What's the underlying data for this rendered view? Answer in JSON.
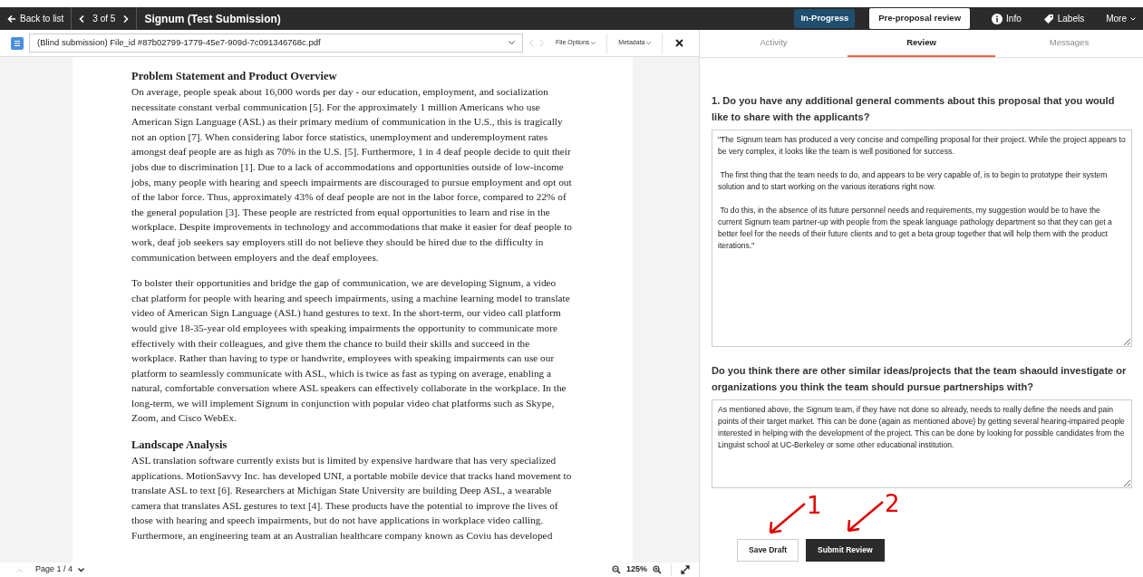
{
  "topbar": {
    "back": "Back to list",
    "pager": "3 of 5",
    "title": "Signum (Test Submission)",
    "status": "In-Progress",
    "stage": "Pre-proposal review",
    "info": "Info",
    "labels": "Labels",
    "more": "More"
  },
  "file_toolbar": {
    "file": "(Blind submission) File_id #87b02799-1779-45e7-909d-7c091346768c.pdf",
    "file_options": "File Options",
    "metadata": "Metadata"
  },
  "document": {
    "sections": [
      {
        "heading": "Problem Statement and Product Overview",
        "paragraphs": [
          "On average, people speak about 16,000 words per day - our education, employment, and socialization necessitate constant verbal communication [5]. For the approximately 1 million Americans who use American Sign Language (ASL) as their primary medium of communication in the U.S., this is tragically not an option [7]. When considering labor force statistics, unemployment and underemployment rates amongst deaf people are as high as 70% in the U.S. [5]. Furthermore, 1 in 4 deaf people decide to quit their jobs due to discrimination [1]. Due to a lack of accommodations and opportunities outside of low-income jobs, many people with hearing and speech impairments are discouraged to pursue employment and opt out of the labor force. Thus, approximately 43% of deaf people are not in the labor force, compared to 22% of the general population [3]. These people are restricted from equal opportunities to learn and rise in the workplace. Despite improvements in technology and accommodations that make it easier for deaf people to work, deaf job seekers say employers still do not believe they should be hired due to the difficulty in communication between employers and the deaf employees.",
          "To bolster their opportunities and bridge the gap of communication, we are developing Signum, a video chat platform for people with hearing and speech impairments, using a machine learning model to translate video of American Sign Language (ASL) hand gestures to text. In the short-term, our video call platform would give 18-35-year old employees with speaking impairments the opportunity to communicate more effectively with their colleagues, and give them the chance to build their skills and succeed in the workplace. Rather than having to type or handwrite, employees with speaking impairments can use our platform to seamlessly communicate with ASL, which is twice as fast as typing on average, enabling a natural, comfortable conversation where ASL speakers can effectively collaborate in the workplace. In the long-term, we will implement Signum in conjunction with popular video chat platforms such as Skype, Zoom, and Cisco WebEx."
        ]
      },
      {
        "heading": "Landscape Analysis",
        "paragraphs": [
          "ASL translation software currently exists but is limited by expensive hardware that has very specialized applications. MotionSavvy Inc. has developed UNI, a portable mobile device that tracks hand movement to translate ASL to text [6]. Researchers at Michigan State University are building Deep ASL, a wearable camera that translates ASL gestures to text [4]. These products have the potential to improve the lives of those with hearing and speech impairments, but do not have applications in workplace video calling. Furthermore, an engineering team at an Australian healthcare company known as Coviu has developed"
        ]
      }
    ]
  },
  "viewer_bar": {
    "page": "Page 1 / 4",
    "zoom": "125%"
  },
  "tabs": [
    {
      "label": "Activity",
      "selected": false
    },
    {
      "label": "Review",
      "selected": true
    },
    {
      "label": "Messages",
      "selected": false
    }
  ],
  "questions": [
    {
      "question": "1. Do you have any additional general comments about this proposal that you would like to share with the applicants?",
      "answer": "\"The Signum team has produced a very concise and compelling proposal for their project. While the project appears to be very complex, it looks like the team is well positioned for success.\n\n The first thing that the team needs to do, and appears to be very capable of, is to begin to prototype their system solution and to start working on the various iterations right now.\n\n To do this, in the absence of its future personnel needs and requirements, my suggestion would be to have the current Signum team partner-up with people from the speak language pathology department so that they can get a better feel for the needs of their future clients and to get a beta group together that will help them with the product iterations.\""
    },
    {
      "question": "Do you think there are other similar ideas/projects that the team shaould investigate or organizations you think the team should pursue partnerships with?",
      "answer": "As mentioned above, the Signum team, if they have not done so already, needs to really define the needs and pain points of their target market. This can be done (again as mentioned above) by getting several hearing-impaired people interested in helping with the development of the project. This can be done by looking for possible candidates from the Linguist school at UC-Berkeley or some other educational institution."
    }
  ],
  "buttons": [
    {
      "label": "Save Draft",
      "kind": "secondary"
    },
    {
      "label": "Submit Review",
      "kind": "primary"
    }
  ],
  "annotations": [
    {
      "label": "1"
    },
    {
      "label": "2"
    }
  ]
}
